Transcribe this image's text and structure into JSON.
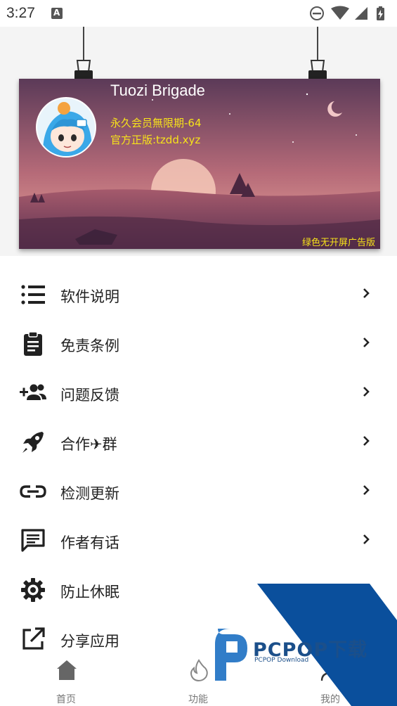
{
  "status_bar": {
    "time": "3:27",
    "icons": [
      "notification-a-icon",
      "do-not-disturb-icon",
      "wifi-icon",
      "cell-signal-icon",
      "battery-icon"
    ]
  },
  "profile": {
    "name": "Tuozi Brigade",
    "vip": "永久会员無限期-64",
    "site": "官方正版:tzdd.xyz",
    "badge": "绿色无开屏广告版"
  },
  "menu": {
    "items": [
      {
        "label": "软件说明",
        "icon": "list-icon"
      },
      {
        "label": "免责条例",
        "icon": "clipboard-icon"
      },
      {
        "label": "问题反馈",
        "icon": "add-group-icon"
      },
      {
        "label": "合作✈群",
        "icon": "rocket-icon"
      },
      {
        "label": "检测更新",
        "icon": "link-icon"
      },
      {
        "label": "作者有话",
        "icon": "message-icon"
      },
      {
        "label": "防止休眠",
        "icon": "gear-icon"
      },
      {
        "label": "分享应用",
        "icon": "external-link-icon"
      }
    ]
  },
  "bottom_nav": {
    "items": [
      {
        "label": "首页",
        "icon": "home-icon"
      },
      {
        "label": "功能",
        "icon": "fire-icon"
      },
      {
        "label": "我的",
        "icon": "person-icon"
      }
    ]
  },
  "watermark": {
    "title": "PCPOP下载",
    "subtitle": "PCPOP Download"
  },
  "colors": {
    "accent_yellow": "#f7e31a",
    "watermark_blue": "#0a4f9c",
    "icon_dark": "#212121"
  }
}
